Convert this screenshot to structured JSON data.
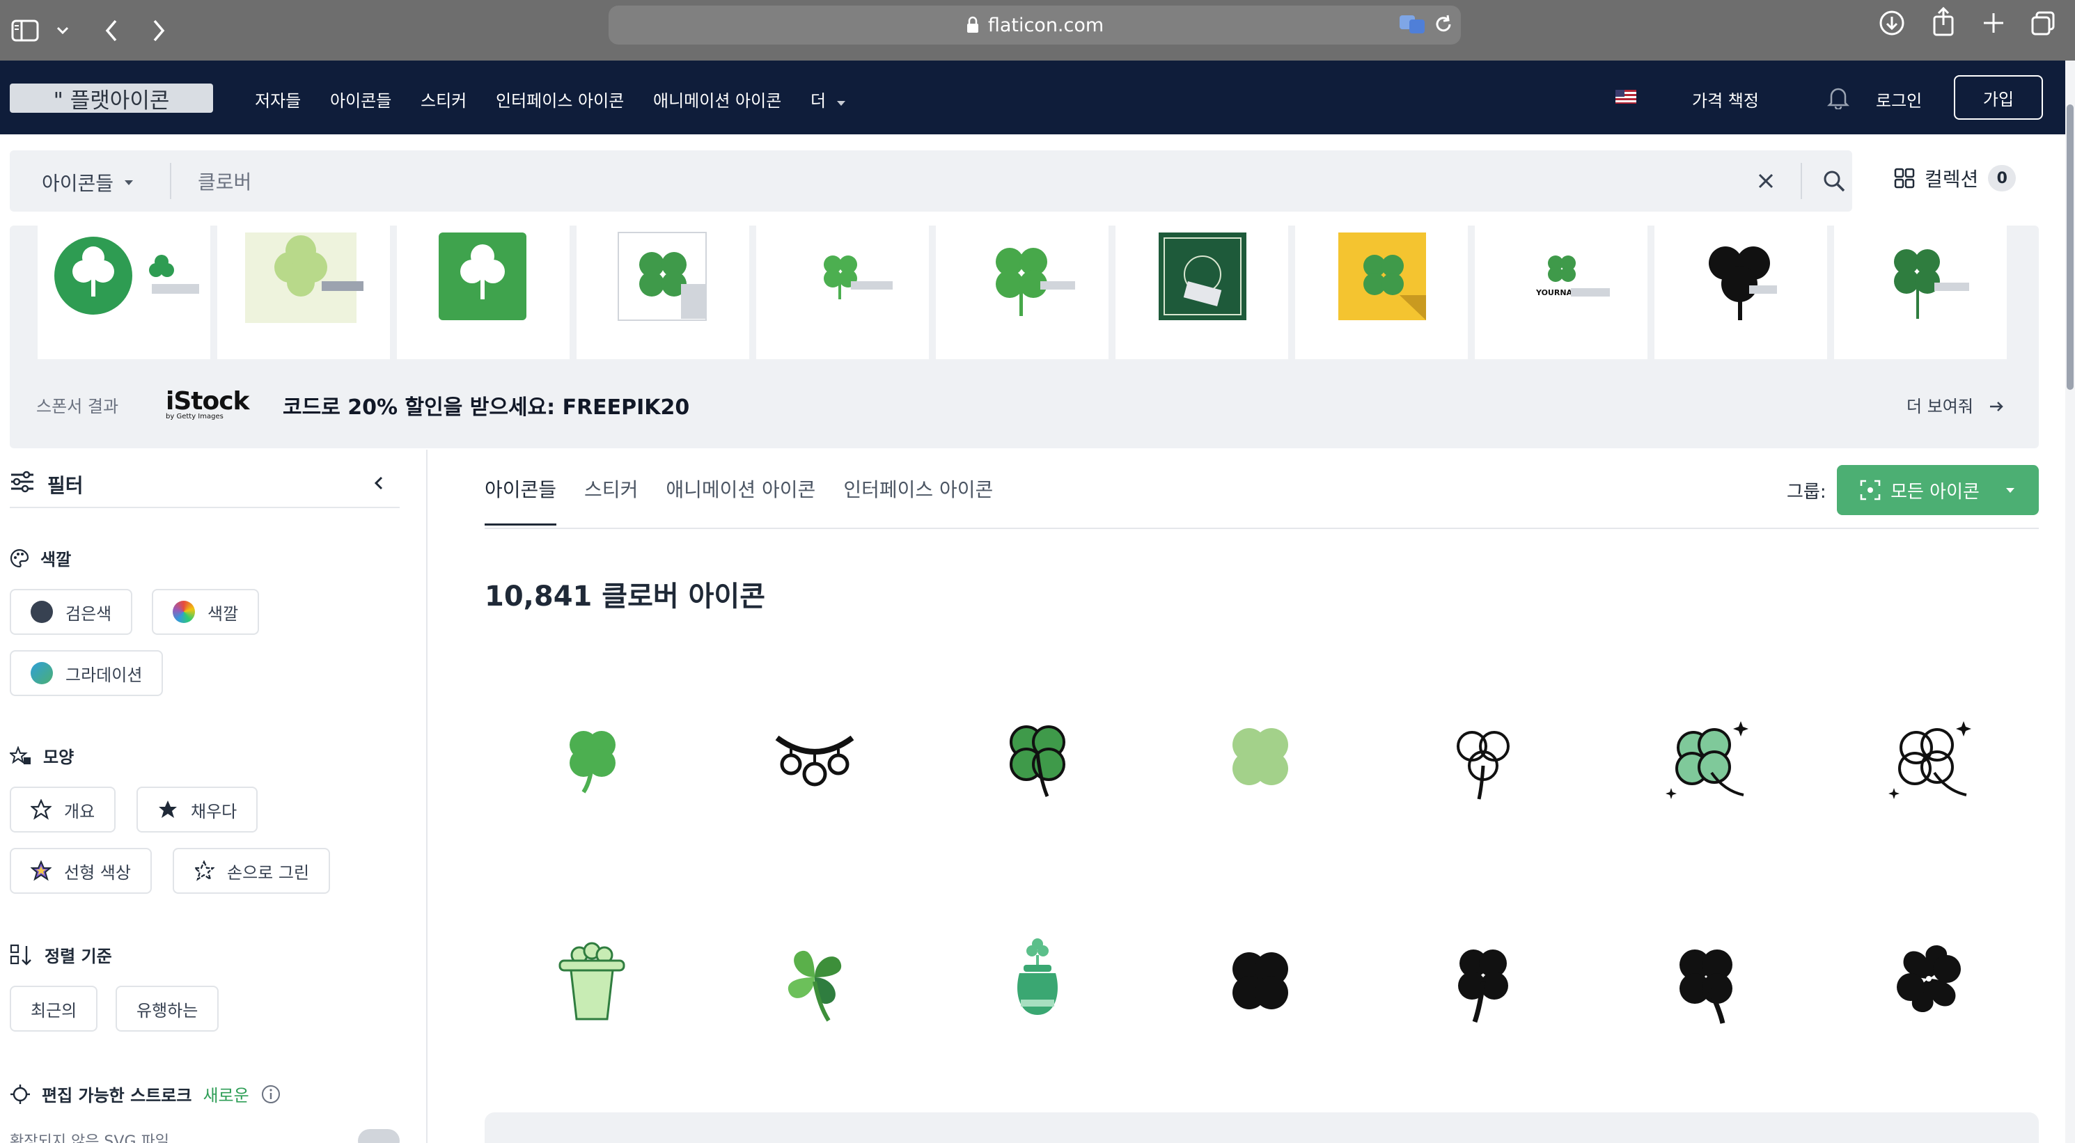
{
  "browser": {
    "url": "flaticon.com",
    "icons": [
      "sidebar-icon",
      "chevron-down-icon",
      "back-icon",
      "forward-icon",
      "lock-icon",
      "translate-icon",
      "reload-icon",
      "download-icon",
      "share-icon",
      "new-tab-icon",
      "tabs-icon"
    ]
  },
  "header": {
    "logo": "\" 플랫아이콘",
    "nav": [
      "저자들",
      "아이콘들",
      "스티커",
      "인터페이스 아이콘",
      "애니메이션 아이콘",
      "더"
    ],
    "pricing": "가격 책정",
    "login": "로그인",
    "signup": "가입"
  },
  "search": {
    "type": "아이콘들",
    "query": "클로버",
    "collections_label": "컬렉션",
    "collections_count": "0"
  },
  "sponsor": {
    "label": "스폰서 결과",
    "brand": "iStock",
    "brand_sub": "by Getty Images",
    "promo": "코드로 20% 할인을 받으세요: FREEPIK20",
    "more": "더 보여줘",
    "thumb_text": "YOURNA"
  },
  "sidebar": {
    "title": "필터",
    "color": {
      "title": "색깔",
      "options": [
        {
          "label": "검은색",
          "color": "#374151"
        },
        {
          "label": "색깔",
          "color": "rainbow"
        },
        {
          "label": "그라데이션",
          "color": "gradient"
        }
      ]
    },
    "shape": {
      "title": "모양",
      "options": [
        "개요",
        "채우다",
        "선형 색상",
        "손으로 그린"
      ]
    },
    "sort": {
      "title": "정렬 기준",
      "options": [
        "최근의",
        "유행하는"
      ]
    },
    "stroke": {
      "title": "편집 가능한 스트로크",
      "new": "새로운",
      "svg_label": "확장되지 않은 SVG 파일"
    }
  },
  "main": {
    "tabs": [
      "아이콘들",
      "스티커",
      "애니메이션 아이콘",
      "인터페이스 아이콘"
    ],
    "group_label": "그룹:",
    "group_value": "모든 아이콘",
    "count_title": "10,841 클로버 아이콘"
  },
  "colors": {
    "header_bg": "#0f1d3a",
    "accent_green": "#4caf73",
    "clover_green": "#3f9a4a"
  }
}
